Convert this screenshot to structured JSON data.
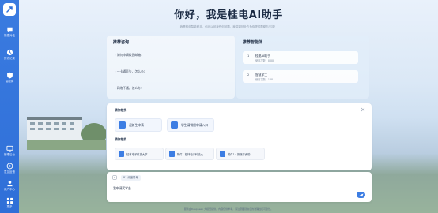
{
  "sidebar": {
    "top_items": [
      {
        "icon": "chat-bubble-icon",
        "label": "新建对话"
      },
      {
        "icon": "history-icon",
        "label": "历史记录"
      },
      {
        "icon": "shield-icon",
        "label": "智能体"
      }
    ],
    "bottom_items": [
      {
        "icon": "monitor-icon",
        "label": "管理后台"
      },
      {
        "icon": "feedback-icon",
        "label": "意见反馈"
      },
      {
        "icon": "user-icon",
        "label": "用户中心"
      },
      {
        "icon": "grid-icon",
        "label": "更多"
      }
    ],
    "accent": "#2f6fd8"
  },
  "header": {
    "title": "你好，我是桂电AI助手",
    "subtitle": "我是桂电智能助手，你可以问我任何问题，我将竭尽全力为你提供帮助与支持！"
  },
  "recommend_questions": {
    "title": "推荐咨询",
    "items": [
      "如何申请校园邮箱?",
      "一卡通丢失，怎么办?",
      "网络不通，怎么办?"
    ]
  },
  "recommend_agents": {
    "title": "推荐智能体",
    "items": [
      {
        "num": "1",
        "name": "桂电AI助手",
        "count": "使用次数：8888"
      },
      {
        "num": "2",
        "name": "智慧学工",
        "count": "使用次数：188"
      }
    ]
  },
  "services": {
    "title": "猜你想找",
    "items": [
      "迎新生申请",
      "学生请销假申请入口"
    ]
  },
  "documents": {
    "title": "猜你想找",
    "items": [
      "桂林电子科技大学...",
      "附件1 桂林电子科技大...",
      "附件1：新媒体资助..."
    ]
  },
  "input": {
    "mode_label": "R1 深度思考",
    "value": "我申请奖学金"
  },
  "footer": {
    "text": "服务由DeepSeek 大模型提供，内容仅供参考，请注意甄别信息的准确性和可靠性。"
  }
}
